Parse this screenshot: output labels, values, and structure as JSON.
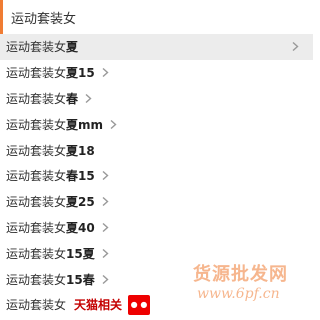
{
  "search": {
    "query": "运动套装女"
  },
  "suggestions": [
    {
      "base": "运动套装女",
      "tail": "夏",
      "has_arrow": true,
      "highlighted": true
    },
    {
      "base": "运动套装女",
      "tail": "夏15",
      "has_arrow": true
    },
    {
      "base": "运动套装女",
      "tail": "春",
      "has_arrow": true
    },
    {
      "base": "运动套装女",
      "tail": "夏mm",
      "has_arrow": true
    },
    {
      "base": "运动套装女",
      "tail": "夏18",
      "has_arrow": false
    },
    {
      "base": "运动套装女",
      "tail": "春15",
      "has_arrow": true
    },
    {
      "base": "运动套装女",
      "tail": "夏25",
      "has_arrow": true
    },
    {
      "base": "运动套装女",
      "tail": "夏40",
      "has_arrow": true
    },
    {
      "base": "运动套装女",
      "tail": "15夏",
      "has_arrow": true
    },
    {
      "base": "运动套装女",
      "tail": "15春",
      "has_arrow": true
    }
  ],
  "tmall_row": {
    "base": "运动套装女",
    "label": "天猫相关",
    "badge_icon": "tmall-cat-icon"
  },
  "watermark": {
    "line1": "货源批发网",
    "line2": "www.6pf.cn"
  },
  "colors": {
    "accent": "#f07c33",
    "tmall_red": "#c40000",
    "highlight_bg": "#ececec"
  }
}
